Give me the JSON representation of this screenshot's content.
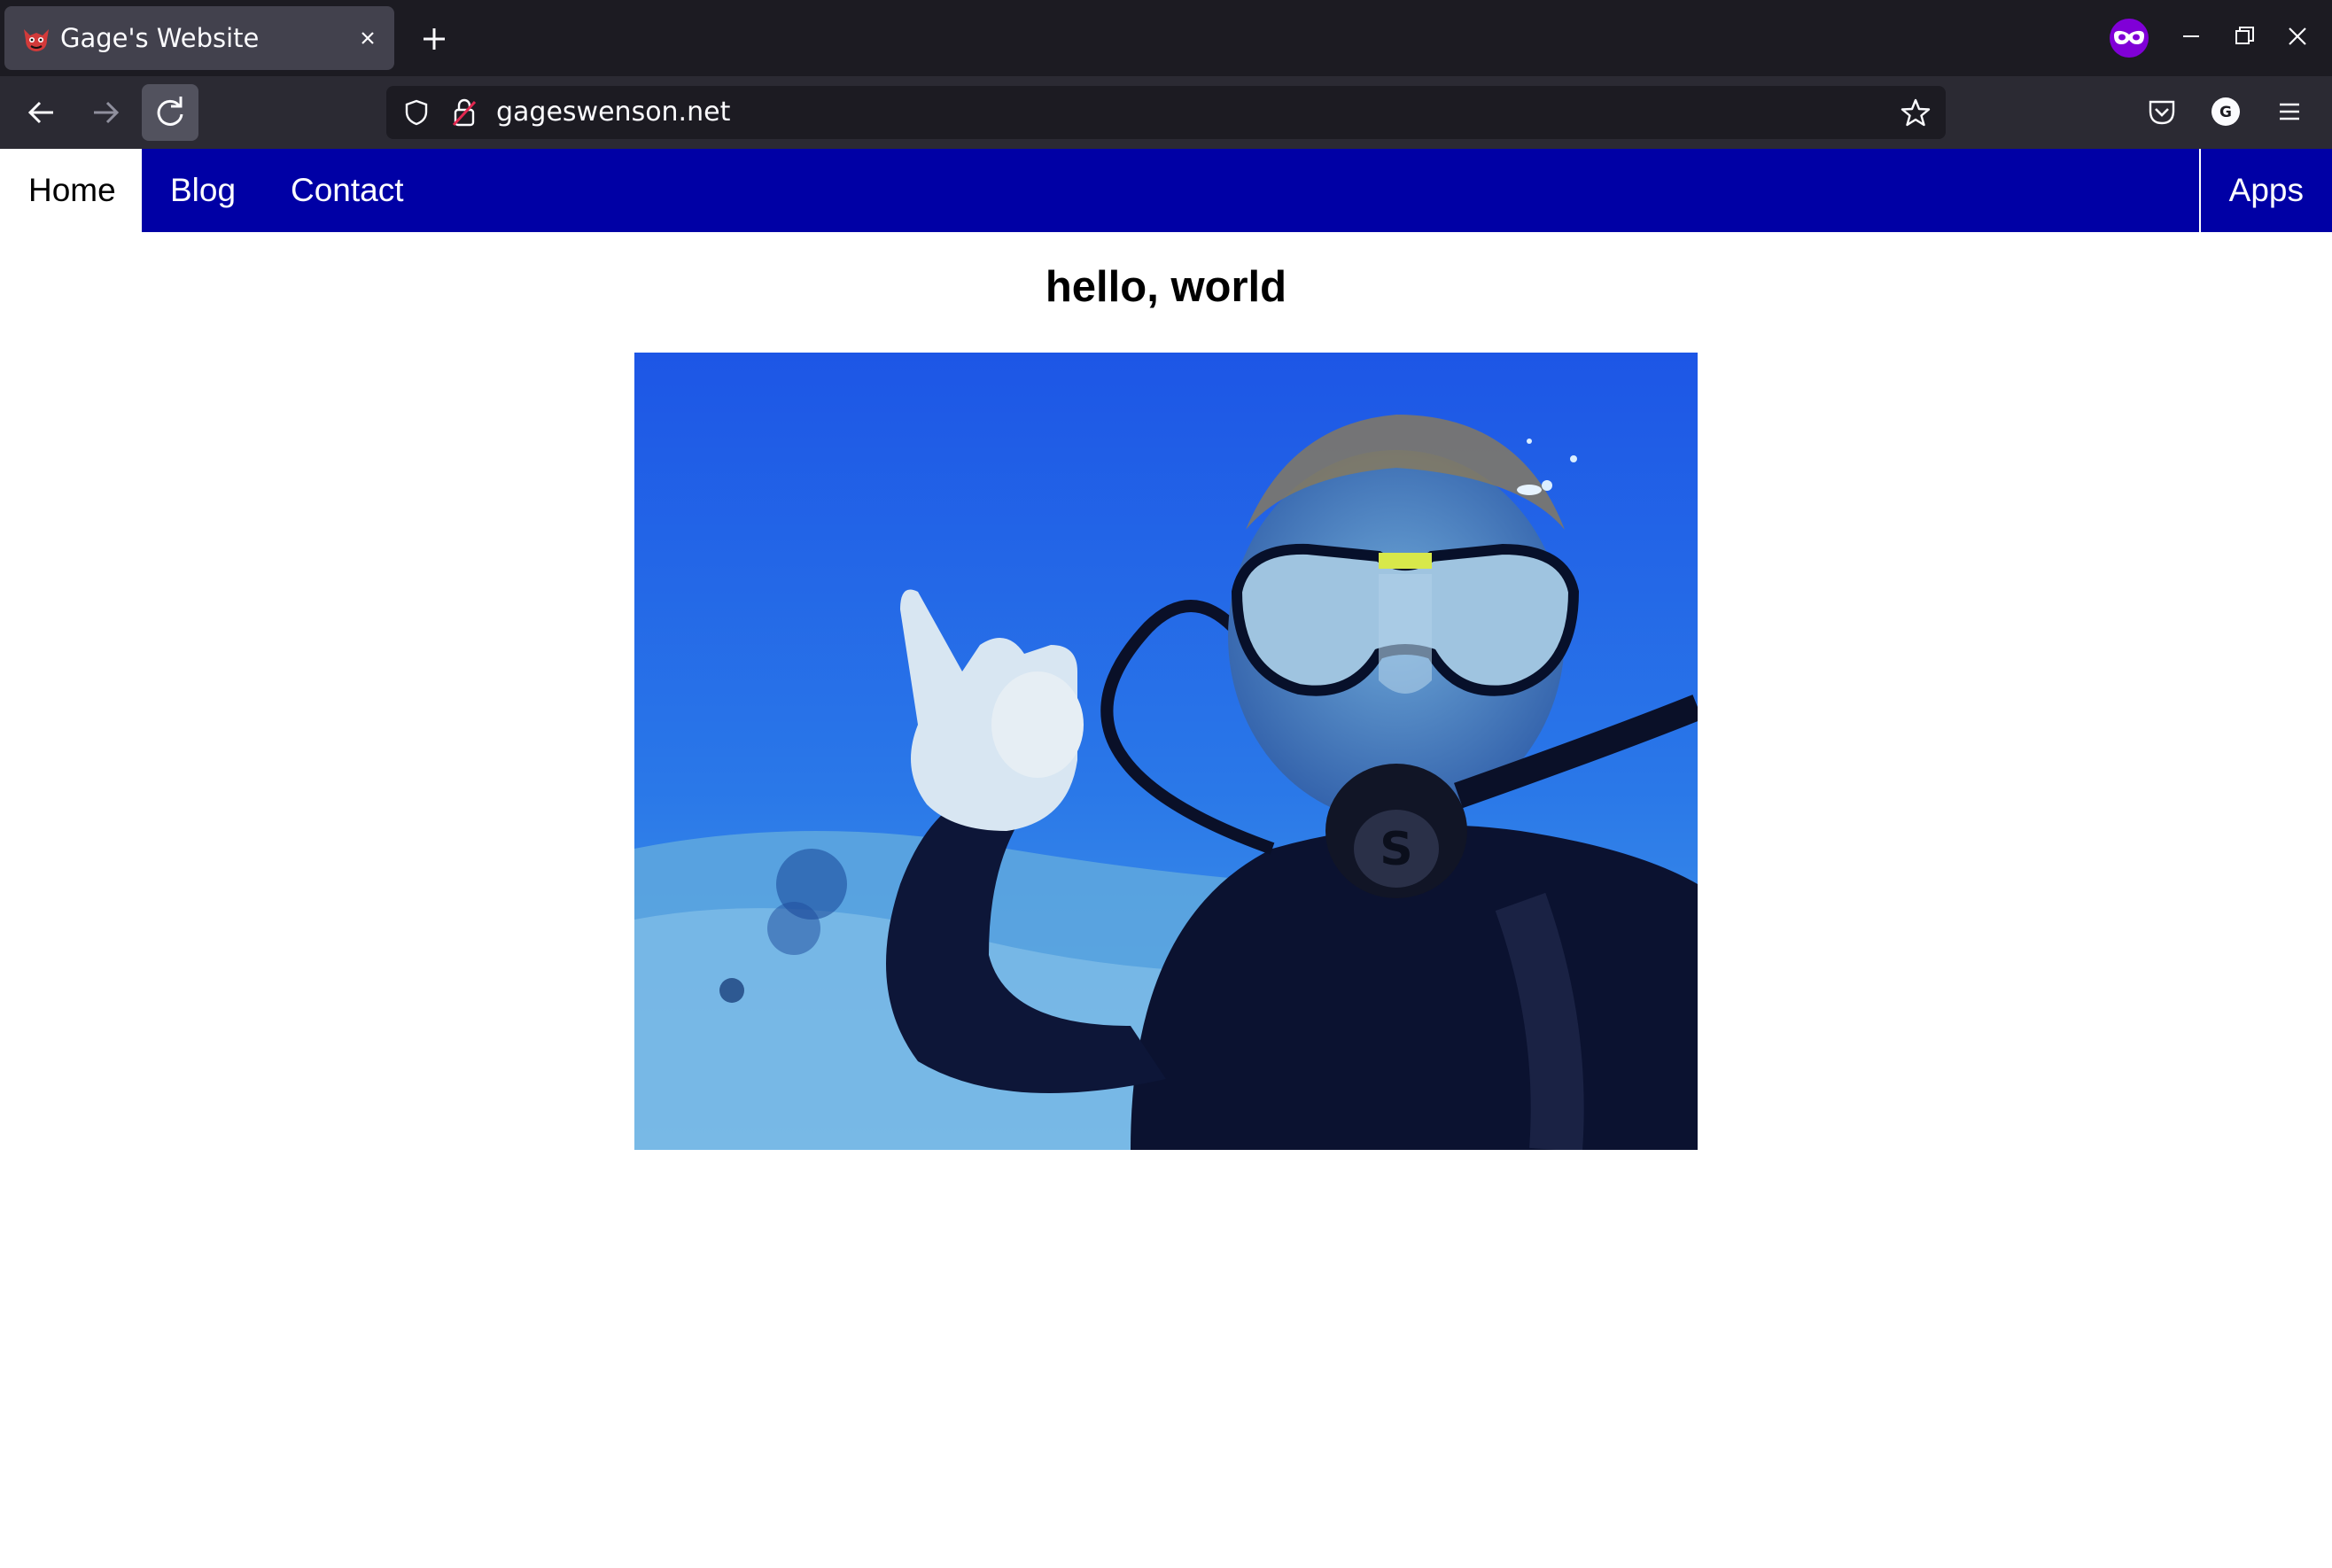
{
  "browser": {
    "tab": {
      "title": "Gage's Website",
      "favicon": "devil-mask-icon"
    },
    "url": "gageswenson.net",
    "icons": [
      "back-arrow-icon",
      "forward-arrow-icon",
      "reload-icon",
      "shield-icon",
      "lock-icon",
      "star-icon",
      "pocket-icon",
      "account-icon",
      "hamburger-menu-icon",
      "private-browsing-icon"
    ],
    "account_initial": "G"
  },
  "nav": {
    "items": [
      {
        "label": "Home",
        "active": true
      },
      {
        "label": "Blog",
        "active": false
      },
      {
        "label": "Contact",
        "active": false
      }
    ],
    "apps_label": "Apps",
    "bar_color": "#0000a5"
  },
  "main": {
    "heading": "hello, world",
    "photo": {
      "subject": "scuba diver underwater holding a sand dollar",
      "colors": {
        "water": "#1e5fe8",
        "deep": "#0a2a9a"
      }
    }
  }
}
